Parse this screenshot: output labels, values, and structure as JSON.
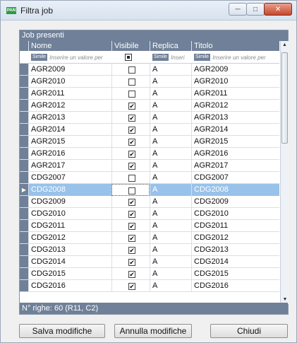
{
  "window": {
    "title": "Filtra job",
    "app_icon": "PAN",
    "buttons": {
      "minimize": "─",
      "maximize": "□",
      "close": "✕"
    }
  },
  "panel": {
    "header": "Job presenti",
    "columns": [
      "Nome",
      "Visibile",
      "Replica",
      "Titolo"
    ],
    "filter": {
      "nome_tag": "Simile",
      "nome_placeholder": "Inserire un valore per",
      "replica_tag": "Simile",
      "replica_placeholder": "Inseri",
      "titolo_tag": "Simile",
      "titolo_placeholder": "Inserire un valore per"
    },
    "rows": [
      {
        "nome": "AGR2009",
        "visibile": false,
        "replica": "A",
        "titolo": "AGR2009"
      },
      {
        "nome": "AGR2010",
        "visibile": false,
        "replica": "A",
        "titolo": "AGR2010"
      },
      {
        "nome": "AGR2011",
        "visibile": false,
        "replica": "A",
        "titolo": "AGR2011"
      },
      {
        "nome": "AGR2012",
        "visibile": true,
        "replica": "A",
        "titolo": "AGR2012"
      },
      {
        "nome": "AGR2013",
        "visibile": true,
        "replica": "A",
        "titolo": "AGR2013"
      },
      {
        "nome": "AGR2014",
        "visibile": true,
        "replica": "A",
        "titolo": "AGR2014"
      },
      {
        "nome": "AGR2015",
        "visibile": true,
        "replica": "A",
        "titolo": "AGR2015"
      },
      {
        "nome": "AGR2016",
        "visibile": true,
        "replica": "A",
        "titolo": "AGR2016"
      },
      {
        "nome": "AGR2017",
        "visibile": true,
        "replica": "A",
        "titolo": "AGR2017"
      },
      {
        "nome": "CDG2007",
        "visibile": false,
        "replica": "A",
        "titolo": "CDG2007"
      },
      {
        "nome": "CDG2008",
        "visibile": false,
        "replica": "A",
        "titolo": "CDG2008",
        "selected": true
      },
      {
        "nome": "CDG2009",
        "visibile": true,
        "replica": "A",
        "titolo": "CDG2009"
      },
      {
        "nome": "CDG2010",
        "visibile": true,
        "replica": "A",
        "titolo": "CDG2010"
      },
      {
        "nome": "CDG2011",
        "visibile": true,
        "replica": "A",
        "titolo": "CDG2011"
      },
      {
        "nome": "CDG2012",
        "visibile": true,
        "replica": "A",
        "titolo": "CDG2012"
      },
      {
        "nome": "CDG2013",
        "visibile": true,
        "replica": "A",
        "titolo": "CDG2013"
      },
      {
        "nome": "CDG2014",
        "visibile": true,
        "replica": "A",
        "titolo": "CDG2014"
      },
      {
        "nome": "CDG2015",
        "visibile": true,
        "replica": "A",
        "titolo": "CDG2015"
      },
      {
        "nome": "CDG2016",
        "visibile": true,
        "replica": "A",
        "titolo": "CDG2016"
      }
    ],
    "status": "N° righe: 60  (R11, C2)"
  },
  "buttons": {
    "salva": "Salva modifiche",
    "annulla": "Annulla modifiche",
    "chiudi": "Chiudi"
  },
  "colors": {
    "header": "#6f8098",
    "selection": "#99c2ea"
  }
}
